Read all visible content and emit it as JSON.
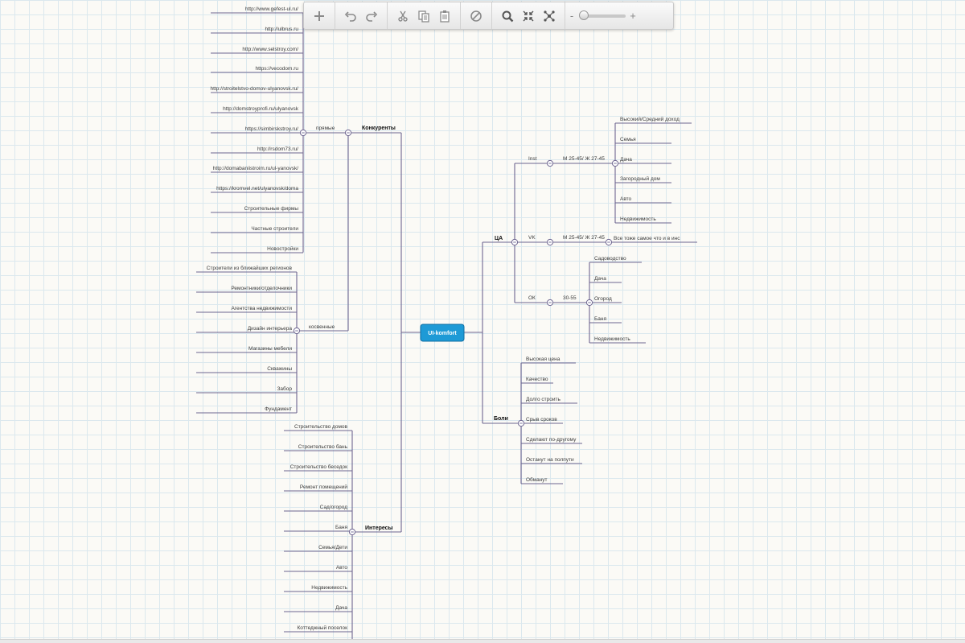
{
  "toolbar": {
    "buttons": [
      {
        "group": 0,
        "icon": "plus-icon",
        "name": "add-topic-button"
      },
      {
        "group": 1,
        "icon": "undo-icon",
        "name": "undo-button"
      },
      {
        "group": 1,
        "icon": "redo-icon",
        "name": "redo-button"
      },
      {
        "group": 2,
        "icon": "scissors-icon",
        "name": "cut-button"
      },
      {
        "group": 2,
        "icon": "copy-icon",
        "name": "copy-button"
      },
      {
        "group": 2,
        "icon": "paste-icon",
        "name": "paste-button"
      },
      {
        "group": 3,
        "icon": "no-entry-icon",
        "name": "delete-button"
      },
      {
        "group": 4,
        "icon": "magnifier-icon",
        "name": "search-button"
      },
      {
        "group": 4,
        "icon": "collapse-icon",
        "name": "fit-button"
      },
      {
        "group": 4,
        "icon": "network-icon",
        "name": "layout-button"
      }
    ],
    "zoom": {
      "minus": "-",
      "plus": "+",
      "level": 0.1
    }
  },
  "root": {
    "label": "UI-komfort"
  },
  "branches": [
    {
      "label": "Конкуренты",
      "bold": true,
      "children": [
        {
          "label": "прямые",
          "children": [
            {
              "label": "http://www.gefest-ul.ru/"
            },
            {
              "label": "http://ulbrus.ru"
            },
            {
              "label": "http://www.selstroy.com/"
            },
            {
              "label": "https://vecodom.ru"
            },
            {
              "label": "http://stroitelstvo-domov-ulyanovsk.ru/"
            },
            {
              "label": "http://domstroyprofi.ru/ulyanovsk"
            },
            {
              "label": "https://simbirskstroy.ru/"
            },
            {
              "label": "http://rsdom73.ru/"
            },
            {
              "label": "http://domabaniistroim.ru/ul-yanovsk/"
            },
            {
              "label": "https://kromvel.net/ulyanovsk/doma"
            },
            {
              "label": "Строительные фирмы"
            },
            {
              "label": "Частные строители"
            },
            {
              "label": "Новостройки"
            }
          ]
        },
        {
          "label": "косвенные",
          "children": [
            {
              "label": "Строители из ближайших регионов"
            },
            {
              "label": "Ремонтники/отделочники"
            },
            {
              "label": "Агентства недвижимости"
            },
            {
              "label": "Дизайн интерьера"
            },
            {
              "label": "Магазины мебели"
            },
            {
              "label": "Скважины"
            },
            {
              "label": "Забор"
            },
            {
              "label": "Фундамент"
            }
          ]
        }
      ]
    },
    {
      "label": "Интересы",
      "bold": true,
      "children": [
        {
          "label": "Строительство домов"
        },
        {
          "label": "Строительство бань"
        },
        {
          "label": "Строительство беседок"
        },
        {
          "label": "Ремонт помещений"
        },
        {
          "label": "Сад/огород"
        },
        {
          "label": "Баня"
        },
        {
          "label": "Семья/Дети"
        },
        {
          "label": "Авто"
        },
        {
          "label": "Недвижимость"
        },
        {
          "label": "Дача"
        },
        {
          "label": "Коттеджный поселок"
        }
      ]
    },
    {
      "label": "ЦА",
      "bold": true,
      "children": [
        {
          "label": "Inst",
          "children": [
            {
              "label": "М 25-45/ Ж 27-45",
              "children": [
                {
                  "label": "Высокий/Средний доход"
                },
                {
                  "label": "Семья"
                },
                {
                  "label": "Дача"
                },
                {
                  "label": "Загородный дом"
                },
                {
                  "label": "Авто"
                },
                {
                  "label": "Недвижимость"
                }
              ]
            }
          ]
        },
        {
          "label": "VK",
          "children": [
            {
              "label": "М 25-45/ Ж 27-45",
              "children": [
                {
                  "label": "Все тоже самое что и в инс"
                }
              ]
            }
          ]
        },
        {
          "label": "ОК",
          "children": [
            {
              "label": "30-55",
              "children": [
                {
                  "label": "Садоводство"
                },
                {
                  "label": "Дача"
                },
                {
                  "label": "Огород"
                },
                {
                  "label": "Баня"
                },
                {
                  "label": "Недвижимость"
                }
              ]
            }
          ]
        }
      ]
    },
    {
      "label": "Боли",
      "bold": true,
      "children": [
        {
          "label": "Высокая цена"
        },
        {
          "label": "Качество"
        },
        {
          "label": "Долго строить"
        },
        {
          "label": "Срыв сроков"
        },
        {
          "label": "Сделают по-другому"
        },
        {
          "label": "Останут на полпути"
        },
        {
          "label": "Обманут"
        }
      ]
    }
  ],
  "colors": {
    "line": "#6e6690",
    "root_fill": "#1e9ad6",
    "root_border": "#0f6ea3",
    "toolbar_icon": "#8a8a8a"
  }
}
